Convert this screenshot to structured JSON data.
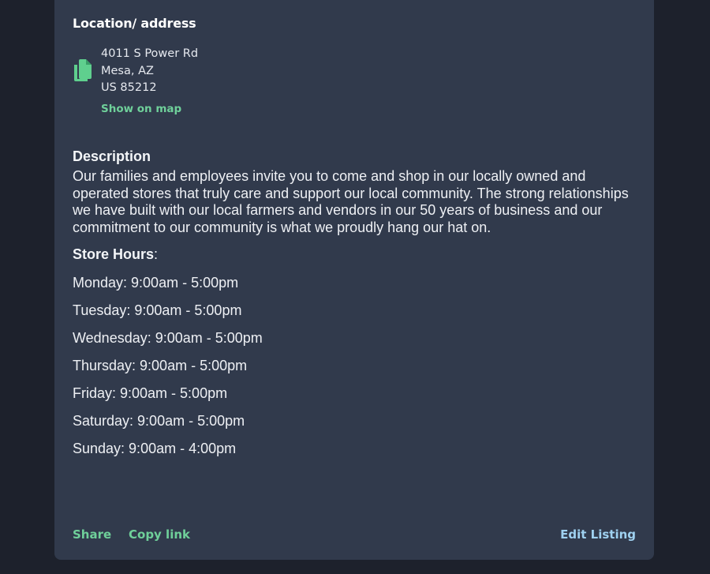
{
  "location": {
    "heading": "Location/ address",
    "address_lines": [
      "4011 S Power Rd",
      "Mesa, AZ",
      "US 85212"
    ],
    "show_on_map": "Show on map"
  },
  "description": {
    "heading": "Description",
    "text": "Our families and employees invite you to come and shop in our locally owned and operated stores that truly care and support our local community. The strong relationships we have built with our local farmers and vendors in our 50 years of business and our commitment to our community is what we proudly hang our hat on."
  },
  "store_hours": {
    "heading": "Store Hours",
    "suffix": ":",
    "days": [
      "Monday: 9:00am - 5:00pm",
      "Tuesday: 9:00am - 5:00pm",
      "Wednesday: 9:00am - 5:00pm",
      "Thursday: 9:00am - 5:00pm",
      "Friday: 9:00am - 5:00pm",
      "Saturday: 9:00am - 5:00pm",
      "Sunday: 9:00am - 4:00pm"
    ]
  },
  "footer": {
    "share": "Share",
    "copy_link": "Copy link",
    "edit_listing": "Edit Listing"
  },
  "icons": {
    "copy_address": "copy-document-icon"
  },
  "colors": {
    "page_background": "#1d212c",
    "card_background": "#313a4c",
    "accent_green": "#6fd09a",
    "accent_blue": "#9fd1f0"
  }
}
